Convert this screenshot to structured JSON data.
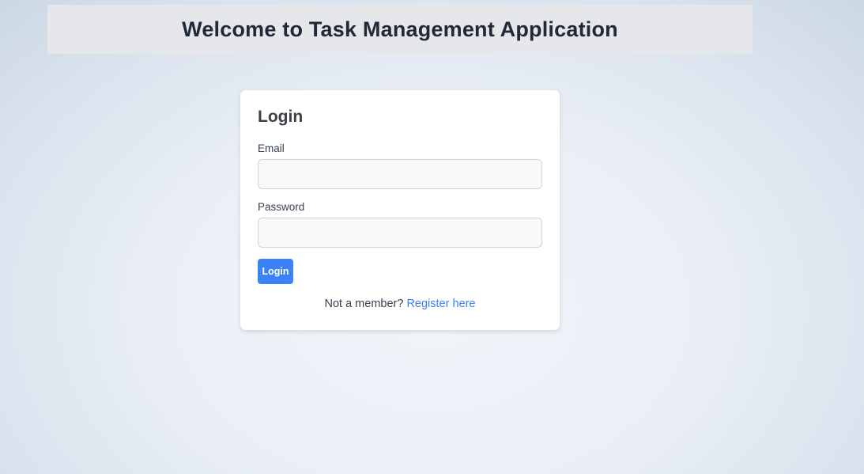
{
  "header": {
    "title": "Welcome to Task Management Application"
  },
  "login_form": {
    "title": "Login",
    "email_label": "Email",
    "email_value": "",
    "password_label": "Password",
    "password_value": "",
    "submit_label": "Login",
    "register_prompt": "Not a member?",
    "register_link": "Register here"
  },
  "colors": {
    "accent": "#3b82f6",
    "header_background": "#e5e7eb",
    "card_background": "#ffffff"
  }
}
